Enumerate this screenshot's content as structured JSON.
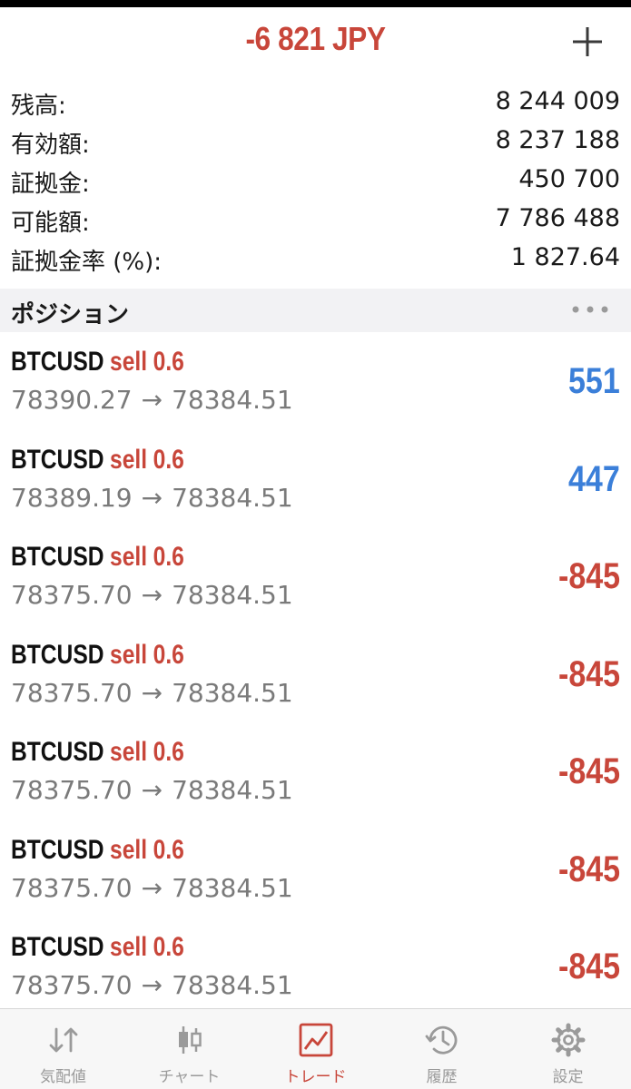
{
  "header": {
    "title": "-6 821 JPY",
    "add_icon": "plus-icon"
  },
  "summary": [
    {
      "label": "残高:",
      "value": "8 244 009"
    },
    {
      "label": "有効額:",
      "value": "8 237 188"
    },
    {
      "label": "証拠金:",
      "value": "450 700"
    },
    {
      "label": "可能額:",
      "value": "7 786 488"
    },
    {
      "label": "証拠金率 (%):",
      "value": "1 827.64"
    }
  ],
  "positions_section": {
    "title": "ポジション",
    "more_icon": "more-dots-icon"
  },
  "positions": [
    {
      "symbol": "BTCUSD",
      "side": "sell",
      "volume": "0.6",
      "open_price": "78390.27",
      "arrow": "→",
      "current_price": "78384.51",
      "profit": "551",
      "profit_sign": "positive"
    },
    {
      "symbol": "BTCUSD",
      "side": "sell",
      "volume": "0.6",
      "open_price": "78389.19",
      "arrow": "→",
      "current_price": "78384.51",
      "profit": "447",
      "profit_sign": "positive"
    },
    {
      "symbol": "BTCUSD",
      "side": "sell",
      "volume": "0.6",
      "open_price": "78375.70",
      "arrow": "→",
      "current_price": "78384.51",
      "profit": "-845",
      "profit_sign": "negative"
    },
    {
      "symbol": "BTCUSD",
      "side": "sell",
      "volume": "0.6",
      "open_price": "78375.70",
      "arrow": "→",
      "current_price": "78384.51",
      "profit": "-845",
      "profit_sign": "negative"
    },
    {
      "symbol": "BTCUSD",
      "side": "sell",
      "volume": "0.6",
      "open_price": "78375.70",
      "arrow": "→",
      "current_price": "78384.51",
      "profit": "-845",
      "profit_sign": "negative"
    },
    {
      "symbol": "BTCUSD",
      "side": "sell",
      "volume": "0.6",
      "open_price": "78375.70",
      "arrow": "→",
      "current_price": "78384.51",
      "profit": "-845",
      "profit_sign": "negative"
    },
    {
      "symbol": "BTCUSD",
      "side": "sell",
      "volume": "0.6",
      "open_price": "78375.70",
      "arrow": "→",
      "current_price": "78384.51",
      "profit": "-845",
      "profit_sign": "negative"
    }
  ],
  "tabbar": {
    "tabs": [
      {
        "label": "気配値",
        "icon": "quotes-arrows-icon",
        "active": false
      },
      {
        "label": "チャート",
        "icon": "candlestick-chart-icon",
        "active": false
      },
      {
        "label": "トレード",
        "icon": "trade-chart-icon",
        "active": true
      },
      {
        "label": "履歴",
        "icon": "history-clock-icon",
        "active": false
      },
      {
        "label": "設定",
        "icon": "settings-gear-icon",
        "active": false
      }
    ]
  },
  "colors": {
    "accent_red": "#c8463a",
    "profit_blue": "#3b7fd9",
    "inactive_gray": "#9a9a9a",
    "section_bg": "#f2f2f4"
  }
}
